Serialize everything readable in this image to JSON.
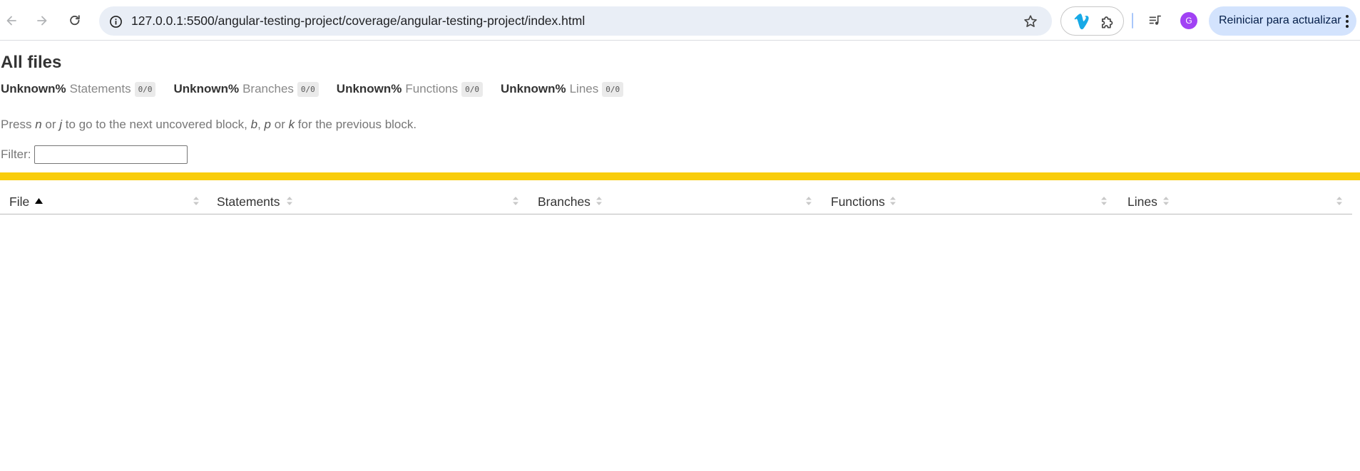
{
  "browser": {
    "url": "127.0.0.1:5500/angular-testing-project/coverage/angular-testing-project/index.html",
    "update_button": "Reiniciar para actualizar",
    "avatar_initial": "G",
    "avatar_color": "#a142f4",
    "icons": {
      "back": "arrow-left-icon",
      "forward": "arrow-right-icon",
      "reload": "reload-icon",
      "site_info": "info-circle-icon",
      "bookmark": "star-icon",
      "extension_vimeo": "vimeo-icon",
      "extensions": "puzzle-icon",
      "media": "media-queue-icon",
      "menu": "kebab-icon"
    }
  },
  "report": {
    "title": "All files",
    "metrics": [
      {
        "pct": "Unknown%",
        "label": "Statements",
        "fraction": "0/0"
      },
      {
        "pct": "Unknown%",
        "label": "Branches",
        "fraction": "0/0"
      },
      {
        "pct": "Unknown%",
        "label": "Functions",
        "fraction": "0/0"
      },
      {
        "pct": "Unknown%",
        "label": "Lines",
        "fraction": "0/0"
      }
    ],
    "hint": {
      "p1": "Press ",
      "k1": "n",
      "p2": " or ",
      "k2": "j",
      "p3": " to go to the next uncovered block, ",
      "k3": "b",
      "p4": ", ",
      "k4": "p",
      "p5": " or ",
      "k5": "k",
      "p6": " for the previous block."
    },
    "filter_label": "Filter:",
    "filter_value": "",
    "status_color": "#f9cd0b",
    "columns": [
      "File",
      "Statements",
      "Branches",
      "Functions",
      "Lines"
    ],
    "sorted_column": "File",
    "sort_direction": "ascending",
    "rows": []
  }
}
